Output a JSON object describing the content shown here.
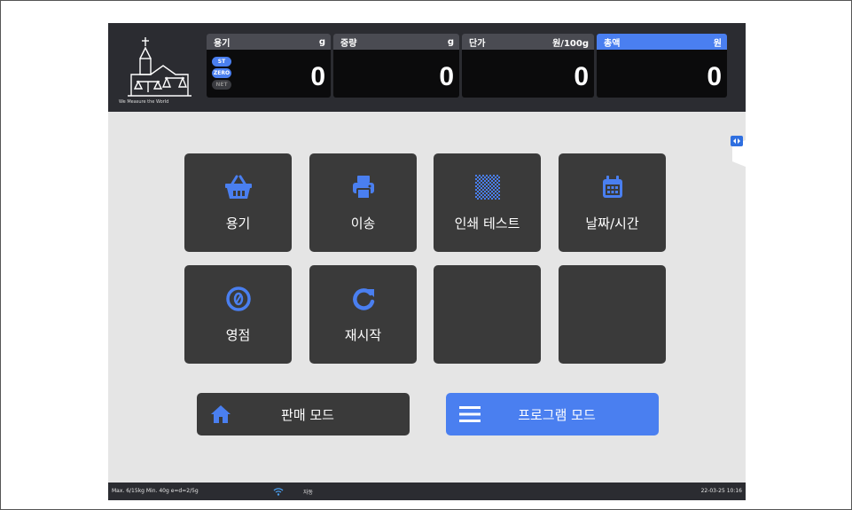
{
  "header": {
    "logo_text": "We Measure the World",
    "panels": [
      {
        "label": "용기",
        "unit": "g",
        "value": "0"
      },
      {
        "label": "중량",
        "unit": "g",
        "value": "0"
      },
      {
        "label": "단가",
        "unit": "원/100g",
        "value": "0"
      },
      {
        "label": "총액",
        "unit": "원",
        "value": "0"
      }
    ],
    "badges": [
      "ST",
      "ZERO",
      "NET"
    ]
  },
  "menu": {
    "tiles": [
      {
        "label": "용기",
        "icon": "basket-icon"
      },
      {
        "label": "이송",
        "icon": "printer-icon"
      },
      {
        "label": "인쇄 테스트",
        "icon": "checker-pattern-icon"
      },
      {
        "label": "날짜/시간",
        "icon": "calendar-icon"
      },
      {
        "label": "영점",
        "icon": "zero-icon"
      },
      {
        "label": "재시작",
        "icon": "restart-icon"
      },
      {
        "label": "",
        "icon": ""
      },
      {
        "label": "",
        "icon": ""
      }
    ]
  },
  "modes": {
    "sales_label": "판매 모드",
    "program_label": "프로그램 모드"
  },
  "status": {
    "left": "Max. 6/15kg  Min. 40g  e=d=2/5g",
    "mode": "자동",
    "datetime": "22-03-25 10:16"
  },
  "colors": {
    "accent": "#4a7ff0",
    "tile": "#3a3a3a",
    "bar": "#2b2c31",
    "background": "#e5e5e5"
  }
}
